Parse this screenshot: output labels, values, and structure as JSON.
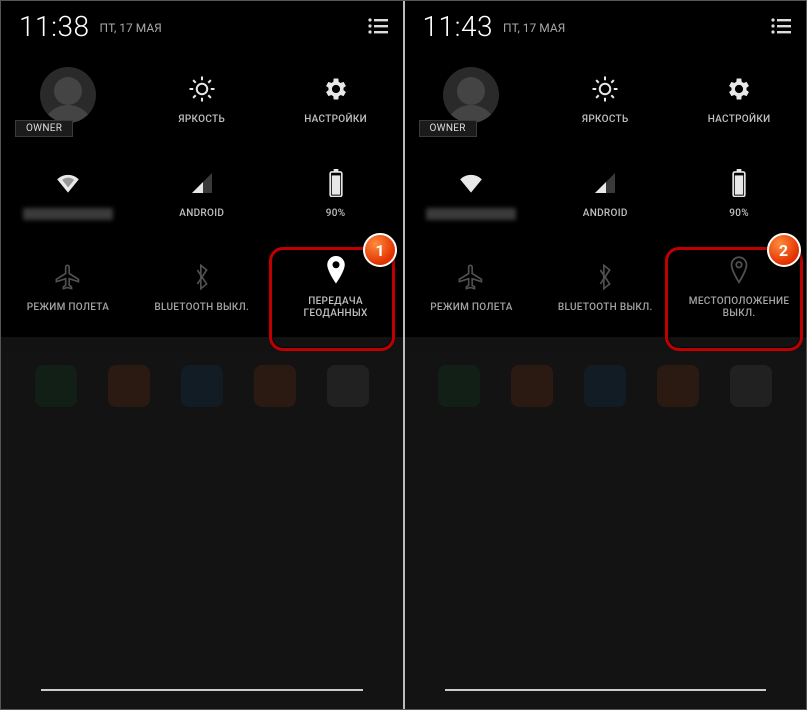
{
  "screens": [
    {
      "clock": "11:38",
      "date": "ПТ, 17 МАЯ",
      "owner_label": "OWNER",
      "tiles": {
        "brightness": "ЯРКОСТЬ",
        "settings": "НАСТРОЙКИ",
        "wifi": "",
        "cell": "ANDROID",
        "battery": "90%",
        "airplane": "РЕЖИМ ПОЛЕТА",
        "bluetooth": "BLUETOOTH ВЫКЛ.",
        "location": "ПЕРЕДАЧА\nГЕОДАННЫХ"
      },
      "callout_number": "1"
    },
    {
      "clock": "11:43",
      "date": "ПТ, 17 МАЯ",
      "owner_label": "OWNER",
      "tiles": {
        "brightness": "ЯРКОСТЬ",
        "settings": "НАСТРОЙКИ",
        "wifi": "",
        "cell": "ANDROID",
        "battery": "90%",
        "airplane": "РЕЖИМ ПОЛЕТА",
        "bluetooth": "BLUETOOTH ВЫКЛ.",
        "location": "МЕСТОПОЛОЖЕНИЕ\nВЫКЛ."
      },
      "callout_number": "2"
    }
  ]
}
